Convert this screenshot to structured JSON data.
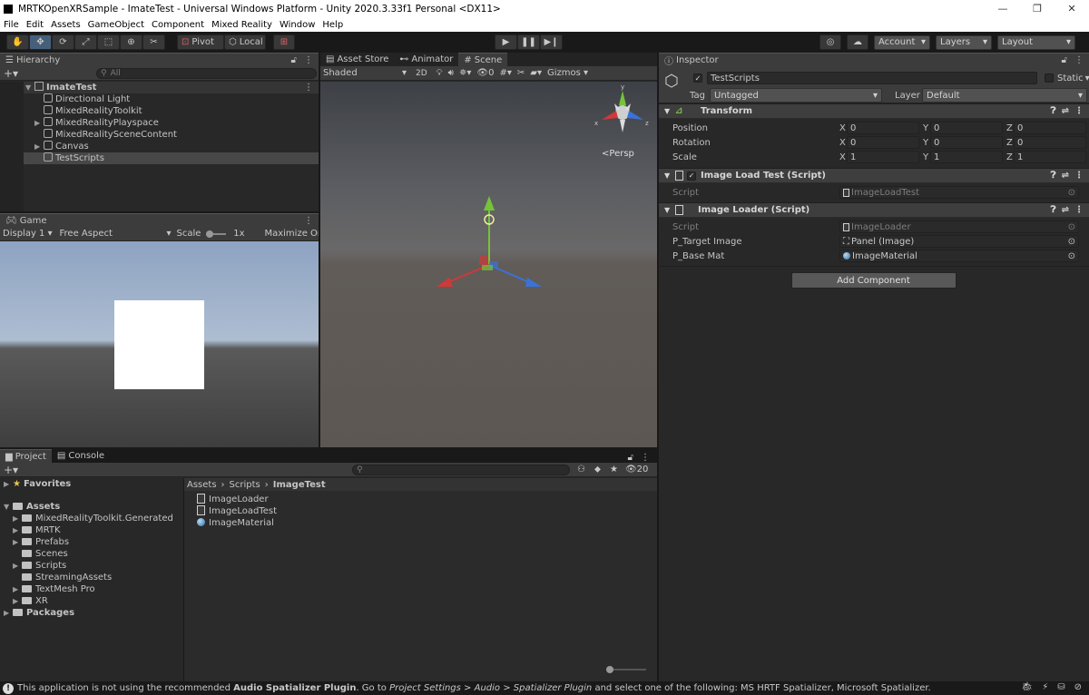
{
  "window": {
    "title": "MRTKOpenXRSample - ImateTest - Universal Windows Platform - Unity 2020.3.33f1 Personal <DX11>",
    "minimize": "—",
    "restore": "❐",
    "close": "✕"
  },
  "menu": [
    "File",
    "Edit",
    "Assets",
    "GameObject",
    "Component",
    "Mixed Reality",
    "Window",
    "Help"
  ],
  "toolbar": {
    "pivot": "Pivot",
    "local": "Local",
    "account": "Account",
    "layers": "Layers",
    "layout": "Layout"
  },
  "hierarchy": {
    "tab": "Hierarchy",
    "search_placeholder": "All",
    "scene": "ImateTest",
    "items": [
      {
        "label": "Directional Light",
        "expandable": false
      },
      {
        "label": "MixedRealityToolkit",
        "expandable": false
      },
      {
        "label": "MixedRealityPlayspace",
        "expandable": true
      },
      {
        "label": "MixedRealitySceneContent",
        "expandable": false
      },
      {
        "label": "Canvas",
        "expandable": true
      },
      {
        "label": "TestScripts",
        "expandable": false,
        "selected": true
      }
    ]
  },
  "game": {
    "tab": "Game",
    "display": "Display 1",
    "aspect": "Free Aspect",
    "scale_label": "Scale",
    "scale_value": "1x",
    "maximize": "Maximize On Play"
  },
  "scene_view": {
    "tabs": [
      "Asset Store",
      "Animator",
      "Scene"
    ],
    "shading": "Shaded",
    "mode_2d": "2D",
    "hidden_count": "0",
    "gizmos": "Gizmos",
    "projection": "Persp"
  },
  "inspector": {
    "tab": "Inspector",
    "object_name": "TestScripts",
    "static_label": "Static",
    "tag_label": "Tag",
    "tag_value": "Untagged",
    "layer_label": "Layer",
    "layer_value": "Default",
    "transform": {
      "title": "Transform",
      "rows": [
        {
          "label": "Position",
          "x": "0",
          "y": "0",
          "z": "0"
        },
        {
          "label": "Rotation",
          "x": "0",
          "y": "0",
          "z": "0"
        },
        {
          "label": "Scale",
          "x": "1",
          "y": "1",
          "z": "1"
        }
      ]
    },
    "image_load_test": {
      "title": "Image Load Test (Script)",
      "script_label": "Script",
      "script_value": "ImageLoadTest"
    },
    "image_loader": {
      "title": "Image Loader (Script)",
      "script_label": "Script",
      "script_value": "ImageLoader",
      "target_label": "P_Target Image",
      "target_value": "Panel (Image)",
      "mat_label": "P_Base Mat",
      "mat_value": "ImageMaterial"
    },
    "add_component": "Add Component"
  },
  "project": {
    "tabs": [
      "Project",
      "Console"
    ],
    "hidden_count": "20",
    "favorites": "Favorites",
    "assets_root": "Assets",
    "folders": [
      "MixedRealityToolkit.Generated",
      "MRTK",
      "Prefabs",
      "Scenes",
      "Scripts",
      "StreamingAssets",
      "TextMesh Pro",
      "XR"
    ],
    "packages": "Packages",
    "breadcrumb": [
      "Assets",
      "Scripts",
      "ImageTest"
    ],
    "files": [
      {
        "name": "ImageLoader",
        "kind": "script"
      },
      {
        "name": "ImageLoadTest",
        "kind": "script"
      },
      {
        "name": "ImageMaterial",
        "kind": "material"
      }
    ]
  },
  "status": {
    "prefix": "This application is not using the recommended ",
    "bold1": "Audio Spatializer Plugin",
    "mid1": ". Go to ",
    "ital1": "Project Settings > Audio > Spatializer Plugin",
    "suffix": " and select one of the following: MS HRTF Spatializer, Microsoft Spatializer."
  },
  "colors": {
    "accent": "#46607c",
    "selected_row": "#474747",
    "x_axis": "#d0383a",
    "y_axis": "#76c33a",
    "z_axis": "#3a72d8"
  }
}
